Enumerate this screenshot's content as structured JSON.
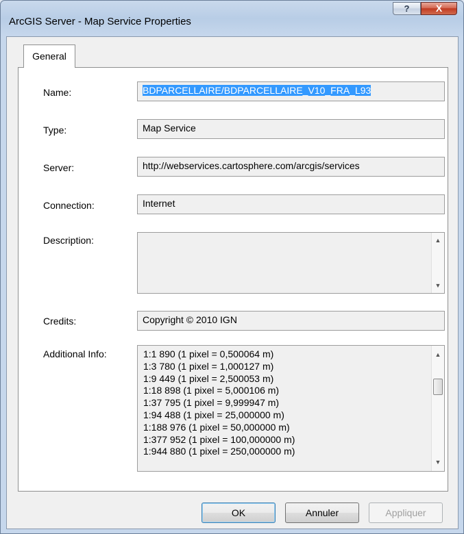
{
  "window": {
    "title": "ArcGIS Server - Map Service Properties",
    "help_label": "?",
    "close_label": "X"
  },
  "tabs": [
    {
      "label": "General"
    }
  ],
  "fields": {
    "name": {
      "label": "Name:",
      "value": "BDPARCELLAIRE/BDPARCELLAIRE_V10_FRA_L93"
    },
    "type": {
      "label": "Type:",
      "value": "Map Service"
    },
    "server": {
      "label": "Server:",
      "value": "http://webservices.cartosphere.com/arcgis/services"
    },
    "connection": {
      "label": "Connection:",
      "value": "Internet"
    },
    "description": {
      "label": "Description:",
      "value": ""
    },
    "credits": {
      "label": "Credits:",
      "value": "Copyright © 2010 IGN"
    },
    "additional_info": {
      "label": "Additional Info:",
      "lines": [
        "1:1 890 (1 pixel = 0,500064 m)",
        "1:3 780 (1 pixel = 1,000127 m)",
        "1:9 449 (1 pixel = 2,500053 m)",
        "1:18 898 (1 pixel = 5,000106 m)",
        "1:37 795 (1 pixel = 9,999947 m)",
        "1:94 488 (1 pixel = 25,000000 m)",
        "1:188 976 (1 pixel = 50,000000 m)",
        "1:377 952 (1 pixel = 100,000000 m)",
        "1:944 880 (1 pixel = 250,000000 m)"
      ]
    }
  },
  "buttons": {
    "ok": "OK",
    "cancel": "Annuler",
    "apply": "Appliquer"
  },
  "scroll_arrows": {
    "up": "▲",
    "down": "▼"
  }
}
